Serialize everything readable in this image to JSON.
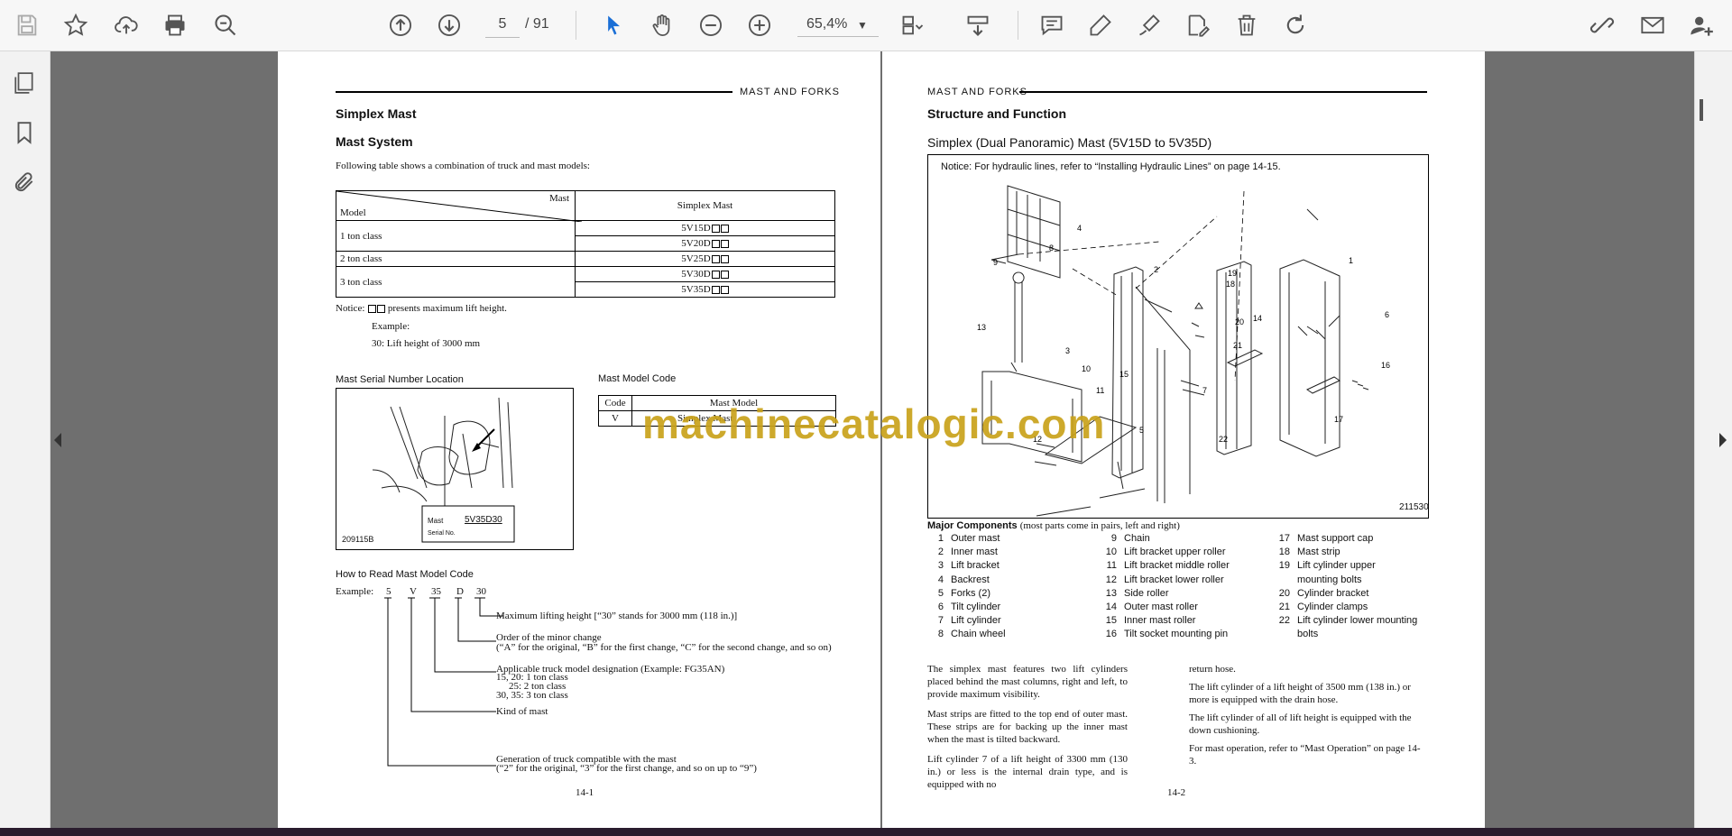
{
  "toolbar": {
    "page_current": "5",
    "page_total": "/ 91",
    "zoom": "65,4%"
  },
  "page1": {
    "header": "MAST AND FORKS",
    "title": "Simplex Mast",
    "section": "Mast System",
    "intro": "Following table shows a combination of truck and mast models:",
    "table_head_mast": "Mast",
    "table_head_model": "Model",
    "table_head_simplex": "Simplex Mast",
    "rows": [
      {
        "cls": "1 ton class",
        "models": [
          "5V15D",
          "5V20D"
        ]
      },
      {
        "cls": "2 ton class",
        "models": [
          "5V25D"
        ]
      },
      {
        "cls": "3 ton class",
        "models": [
          "5V30D",
          "5V35D"
        ]
      }
    ],
    "notice_prefix": "Notice:",
    "notice_suffix": "presents maximum lift height.",
    "example": "Example:",
    "example_line": "30:    Lift height of 3000 mm",
    "serial_title": "Mast Serial Number Location",
    "serial_fig_code": "209115B",
    "serial_mast_label": "Mast",
    "serial_mast_value": "5V35D30",
    "serial_no_label": "Serial No.",
    "model_code_title": "Mast Model Code",
    "model_code_head_code": "Code",
    "model_code_head_model": "Mast Model",
    "model_code_val_code": "V",
    "model_code_val_model": "Simplex Mast",
    "read_title": "How to Read Mast Model Code",
    "read_example": "Example:",
    "read_chars": [
      "5",
      "V",
      "35",
      "D",
      "30"
    ],
    "read_lines": [
      "Maximum lifting height [“30” stands for 3000 mm (118 in.)]",
      "Order of the minor change",
      "(“A” for the original, “B” for the first change, “C” for the second change, and so on)",
      "Applicable truck model designation (Example: FG35AN)",
      "15, 20: 1 ton class",
      "25: 2 ton class",
      "30, 35: 3 ton class",
      "Kind of mast",
      "Generation of truck compatible with the mast",
      "(“2” for the original, “3” for the first change, and so on up to “9”)"
    ],
    "page_number": "14-1"
  },
  "page2": {
    "header": "MAST AND FORKS",
    "title": "Structure and Function",
    "subtitle": "Simplex (Dual Panoramic) Mast (5V15D to 5V35D)",
    "fig_notice": "Notice:  For hydraulic lines, refer to “Installing Hydraulic Lines” on page 14-15.",
    "fig_code": "211530",
    "components_title": "Major Components",
    "components_note": "(most parts come in pairs, left and right)",
    "components": [
      {
        "n": "1",
        "t": "Outer mast"
      },
      {
        "n": "2",
        "t": "Inner mast"
      },
      {
        "n": "3",
        "t": "Lift bracket"
      },
      {
        "n": "4",
        "t": "Backrest"
      },
      {
        "n": "5",
        "t": "Forks (2)"
      },
      {
        "n": "6",
        "t": "Tilt cylinder"
      },
      {
        "n": "7",
        "t": "Lift cylinder"
      },
      {
        "n": "8",
        "t": "Chain wheel"
      },
      {
        "n": "9",
        "t": "Chain"
      },
      {
        "n": "10",
        "t": "Lift bracket upper roller"
      },
      {
        "n": "11",
        "t": "Lift bracket middle roller"
      },
      {
        "n": "12",
        "t": "Lift bracket lower roller"
      },
      {
        "n": "13",
        "t": "Side roller"
      },
      {
        "n": "14",
        "t": "Outer mast roller"
      },
      {
        "n": "15",
        "t": "Inner mast roller"
      },
      {
        "n": "16",
        "t": "Tilt socket mounting pin"
      },
      {
        "n": "17",
        "t": "Mast support cap"
      },
      {
        "n": "18",
        "t": "Mast strip"
      },
      {
        "n": "19",
        "t": "Lift cylinder upper mounting bolts"
      },
      {
        "n": "20",
        "t": "Cylinder bracket"
      },
      {
        "n": "21",
        "t": "Cylinder clamps"
      },
      {
        "n": "22",
        "t": "Lift cylinder lower mounting bolts"
      }
    ],
    "para_left": [
      "The simplex mast features two lift cylinders placed behind the mast columns, right and left, to provide maximum visibility.",
      "Mast strips are fitted to the top end of outer mast. These strips are for backing up the inner mast when the mast is tilted backward.",
      "Lift cylinder 7 of a lift height of 3300 mm (130 in.) or less is the internal drain type, and is equipped with no"
    ],
    "para_right": [
      "return hose.",
      "The lift cylinder of a lift height of 3500 mm (138 in.) or more is equipped with the drain hose.",
      "The lift cylinder of all of lift height is equipped with the down cushioning.",
      "For mast operation, refer to “Mast Operation” on page 14-3."
    ],
    "page_number": "14-2"
  },
  "watermark": "machinecatalogic.com"
}
